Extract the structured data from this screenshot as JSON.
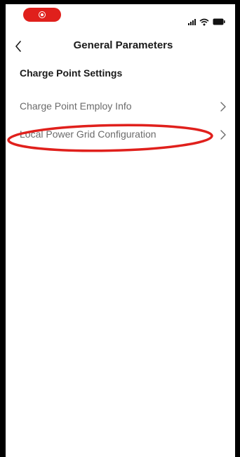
{
  "status_bar": {
    "record_indicator": "record-icon",
    "icons": [
      "signal-icon",
      "wifi-icon",
      "battery-icon"
    ]
  },
  "header": {
    "back_icon": "chevron-left-icon",
    "title": "General Parameters"
  },
  "section": {
    "title": "Charge Point Settings"
  },
  "items": [
    {
      "label": "Charge Point Employ Info",
      "icon": "chevron-right-icon"
    },
    {
      "label": "Local Power Grid Configuration",
      "icon": "chevron-right-icon"
    }
  ],
  "annotation": {
    "highlighted_item": "Local Power Grid Configuration"
  },
  "colors": {
    "record": "#e0201c",
    "annotation": "#e0201c",
    "text_primary": "#1a1a1a",
    "text_secondary": "#6b6b6b",
    "frame": "#000000"
  }
}
